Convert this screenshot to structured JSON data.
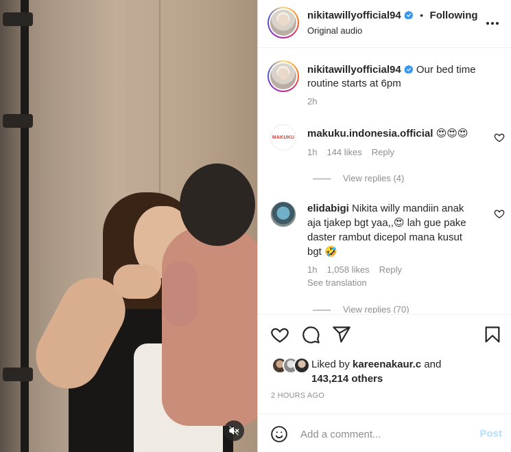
{
  "header": {
    "username": "nikitawillyofficial94",
    "separator": "•",
    "following_label": "Following",
    "audio": "Original audio"
  },
  "caption": {
    "username": "nikitawillyofficial94",
    "text": "Our bed time routine starts at 6pm",
    "time": "2h"
  },
  "comments": [
    {
      "username": "makuku.indonesia.official",
      "avatar_text": "MAKUKU",
      "text": "😍😍😍",
      "time": "1h",
      "likes": "144 likes",
      "reply_label": "Reply",
      "view_replies": "View replies (4)"
    },
    {
      "username": "elidabigi",
      "text": "Nikita willy mandiin anak aja tjakep bgt yaa,,😍 lah gue pake daster rambut dicepol mana kusut bgt 🤣",
      "time": "1h",
      "likes": "1,058 likes",
      "reply_label": "Reply",
      "see_translation": "See translation",
      "view_replies": "View replies (70)"
    }
  ],
  "likes": {
    "prefix": "Liked by",
    "user": "kareenakaur.c",
    "joiner": "and",
    "others": "143,214 others"
  },
  "post_date": "2 HOURS AGO",
  "add_comment": {
    "placeholder": "Add a comment...",
    "post_label": "Post"
  },
  "icons": {
    "verified": "verified-badge-icon",
    "more": "more-options-icon",
    "heart": "heart-icon",
    "comment": "comment-icon",
    "share": "share-icon",
    "save": "bookmark-icon",
    "emoji": "emoji-icon",
    "mute": "audio-muted-icon"
  },
  "colors": {
    "verified_blue": "#3897f0",
    "post_button_disabled": "#b2dffc",
    "secondary_text": "#8e8e8e"
  }
}
